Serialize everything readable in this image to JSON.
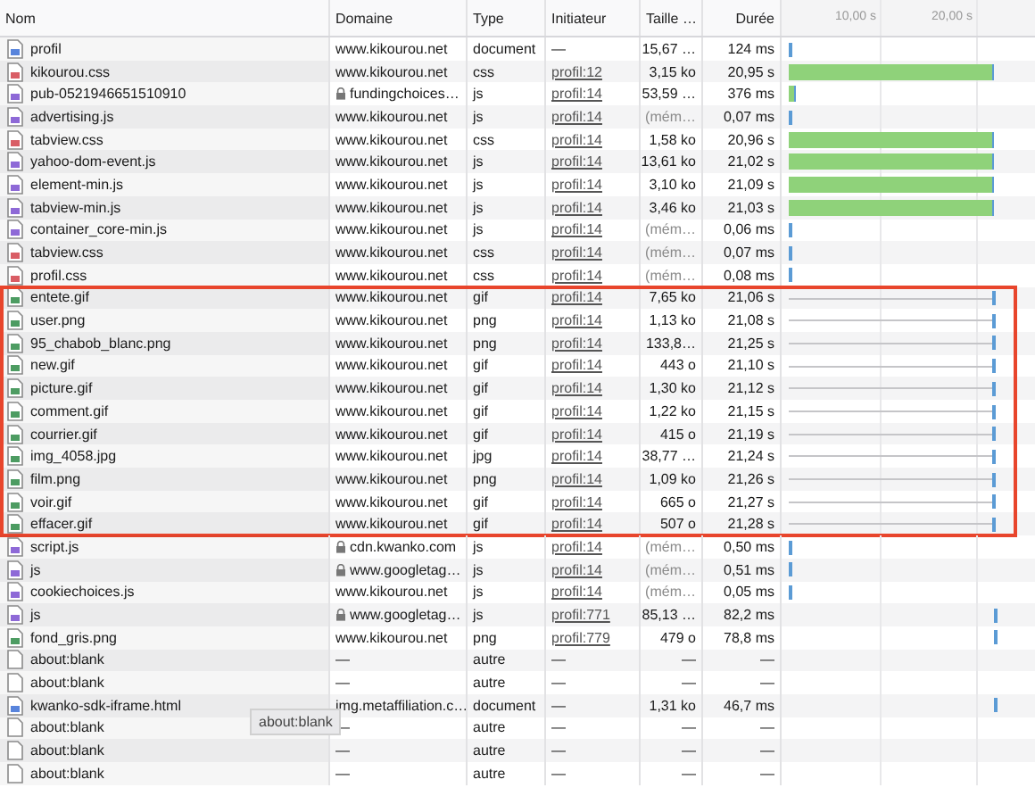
{
  "columns": [
    "Nom",
    "Domaine",
    "Type",
    "Initiateur",
    "Taille …",
    "Durée"
  ],
  "timeline": {
    "ticks": [
      "10,00 s",
      "20,00 s"
    ]
  },
  "groups": [
    {
      "highlighted": false,
      "rows": [
        {
          "name": "profil",
          "kind": "doc",
          "domain": "www.kikourou.net",
          "secure": false,
          "type": "document",
          "initiator": "—",
          "initiator_link": false,
          "size": "15,67 …",
          "cached": false,
          "duration": "124 ms",
          "timing": {
            "kind": "instant"
          }
        },
        {
          "name": "kikourou.css",
          "kind": "css",
          "domain": "www.kikourou.net",
          "secure": false,
          "type": "css",
          "initiator": "profil:12",
          "initiator_link": true,
          "size": "3,15 ko",
          "cached": false,
          "duration": "20,95 s",
          "timing": {
            "kind": "download"
          }
        },
        {
          "name": "pub-0521946651510910",
          "kind": "js",
          "domain": "fundingchoices…",
          "secure": true,
          "type": "js",
          "initiator": "profil:14",
          "initiator_link": true,
          "size": "53,59 …",
          "cached": false,
          "duration": "376 ms",
          "timing": {
            "kind": "short"
          }
        },
        {
          "name": "advertising.js",
          "kind": "js",
          "domain": "www.kikourou.net",
          "secure": false,
          "type": "js",
          "initiator": "profil:14",
          "initiator_link": true,
          "size": "(mém…",
          "cached": true,
          "duration": "0,07 ms",
          "timing": {
            "kind": "instant"
          }
        },
        {
          "name": "tabview.css",
          "kind": "css",
          "domain": "www.kikourou.net",
          "secure": false,
          "type": "css",
          "initiator": "profil:14",
          "initiator_link": true,
          "size": "1,58 ko",
          "cached": false,
          "duration": "20,96 s",
          "timing": {
            "kind": "download"
          }
        },
        {
          "name": "yahoo-dom-event.js",
          "kind": "js",
          "domain": "www.kikourou.net",
          "secure": false,
          "type": "js",
          "initiator": "profil:14",
          "initiator_link": true,
          "size": "13,61 ko",
          "cached": false,
          "duration": "21,02 s",
          "timing": {
            "kind": "download"
          }
        },
        {
          "name": "element-min.js",
          "kind": "js",
          "domain": "www.kikourou.net",
          "secure": false,
          "type": "js",
          "initiator": "profil:14",
          "initiator_link": true,
          "size": "3,10 ko",
          "cached": false,
          "duration": "21,09 s",
          "timing": {
            "kind": "download"
          }
        },
        {
          "name": "tabview-min.js",
          "kind": "js",
          "domain": "www.kikourou.net",
          "secure": false,
          "type": "js",
          "initiator": "profil:14",
          "initiator_link": true,
          "size": "3,46 ko",
          "cached": false,
          "duration": "21,03 s",
          "timing": {
            "kind": "download"
          }
        },
        {
          "name": "container_core-min.js",
          "kind": "js",
          "domain": "www.kikourou.net",
          "secure": false,
          "type": "js",
          "initiator": "profil:14",
          "initiator_link": true,
          "size": "(mém…",
          "cached": true,
          "duration": "0,06 ms",
          "timing": {
            "kind": "instant"
          }
        },
        {
          "name": "tabview.css",
          "kind": "css",
          "domain": "www.kikourou.net",
          "secure": false,
          "type": "css",
          "initiator": "profil:14",
          "initiator_link": true,
          "size": "(mém…",
          "cached": true,
          "duration": "0,07 ms",
          "timing": {
            "kind": "instant"
          }
        },
        {
          "name": "profil.css",
          "kind": "css",
          "domain": "www.kikourou.net",
          "secure": false,
          "type": "css",
          "initiator": "profil:14",
          "initiator_link": true,
          "size": "(mém…",
          "cached": true,
          "duration": "0,08 ms",
          "timing": {
            "kind": "instant"
          }
        }
      ]
    },
    {
      "highlighted": true,
      "rows": [
        {
          "name": "entete.gif",
          "kind": "img",
          "domain": "www.kikourou.net",
          "secure": false,
          "type": "gif",
          "initiator": "profil:14",
          "initiator_link": true,
          "size": "7,65 ko",
          "cached": false,
          "duration": "21,06 s",
          "timing": {
            "kind": "waiting"
          }
        },
        {
          "name": "user.png",
          "kind": "img",
          "domain": "www.kikourou.net",
          "secure": false,
          "type": "png",
          "initiator": "profil:14",
          "initiator_link": true,
          "size": "1,13 ko",
          "cached": false,
          "duration": "21,08 s",
          "timing": {
            "kind": "waiting"
          }
        },
        {
          "name": "95_chabob_blanc.png",
          "kind": "img",
          "domain": "www.kikourou.net",
          "secure": false,
          "type": "png",
          "initiator": "profil:14",
          "initiator_link": true,
          "size": "133,8…",
          "cached": false,
          "duration": "21,25 s",
          "timing": {
            "kind": "waiting"
          }
        },
        {
          "name": "new.gif",
          "kind": "img",
          "domain": "www.kikourou.net",
          "secure": false,
          "type": "gif",
          "initiator": "profil:14",
          "initiator_link": true,
          "size": "443 o",
          "cached": false,
          "duration": "21,10 s",
          "timing": {
            "kind": "waiting"
          }
        },
        {
          "name": "picture.gif",
          "kind": "img",
          "domain": "www.kikourou.net",
          "secure": false,
          "type": "gif",
          "initiator": "profil:14",
          "initiator_link": true,
          "size": "1,30 ko",
          "cached": false,
          "duration": "21,12 s",
          "timing": {
            "kind": "waiting"
          }
        },
        {
          "name": "comment.gif",
          "kind": "img",
          "domain": "www.kikourou.net",
          "secure": false,
          "type": "gif",
          "initiator": "profil:14",
          "initiator_link": true,
          "size": "1,22 ko",
          "cached": false,
          "duration": "21,15 s",
          "timing": {
            "kind": "waiting"
          }
        },
        {
          "name": "courrier.gif",
          "kind": "img",
          "domain": "www.kikourou.net",
          "secure": false,
          "type": "gif",
          "initiator": "profil:14",
          "initiator_link": true,
          "size": "415 o",
          "cached": false,
          "duration": "21,19 s",
          "timing": {
            "kind": "waiting"
          }
        },
        {
          "name": "img_4058.jpg",
          "kind": "img",
          "domain": "www.kikourou.net",
          "secure": false,
          "type": "jpg",
          "initiator": "profil:14",
          "initiator_link": true,
          "size": "38,77 …",
          "cached": false,
          "duration": "21,24 s",
          "timing": {
            "kind": "waiting"
          }
        },
        {
          "name": "film.png",
          "kind": "img",
          "domain": "www.kikourou.net",
          "secure": false,
          "type": "png",
          "initiator": "profil:14",
          "initiator_link": true,
          "size": "1,09 ko",
          "cached": false,
          "duration": "21,26 s",
          "timing": {
            "kind": "waiting"
          }
        },
        {
          "name": "voir.gif",
          "kind": "img",
          "domain": "www.kikourou.net",
          "secure": false,
          "type": "gif",
          "initiator": "profil:14",
          "initiator_link": true,
          "size": "665 o",
          "cached": false,
          "duration": "21,27 s",
          "timing": {
            "kind": "waiting"
          }
        },
        {
          "name": "effacer.gif",
          "kind": "img",
          "domain": "www.kikourou.net",
          "secure": false,
          "type": "gif",
          "initiator": "profil:14",
          "initiator_link": true,
          "size": "507 o",
          "cached": false,
          "duration": "21,28 s",
          "timing": {
            "kind": "waiting"
          }
        }
      ]
    },
    {
      "highlighted": false,
      "rows": [
        {
          "name": "script.js",
          "kind": "js",
          "domain": "cdn.kwanko.com",
          "secure": true,
          "type": "js",
          "initiator": "profil:14",
          "initiator_link": true,
          "size": "(mém…",
          "cached": true,
          "duration": "0,50 ms",
          "timing": {
            "kind": "instant"
          }
        },
        {
          "name": "js",
          "kind": "js",
          "domain": "www.googletag…",
          "secure": true,
          "type": "js",
          "initiator": "profil:14",
          "initiator_link": true,
          "size": "(mém…",
          "cached": true,
          "duration": "0,51 ms",
          "timing": {
            "kind": "instant"
          }
        },
        {
          "name": "cookiechoices.js",
          "kind": "js",
          "domain": "www.kikourou.net",
          "secure": false,
          "type": "js",
          "initiator": "profil:14",
          "initiator_link": true,
          "size": "(mém…",
          "cached": true,
          "duration": "0,05 ms",
          "timing": {
            "kind": "instant"
          }
        },
        {
          "name": "js",
          "kind": "js",
          "domain": "www.googletag…",
          "secure": true,
          "type": "js",
          "initiator": "profil:771",
          "initiator_link": true,
          "size": "85,13 …",
          "cached": false,
          "duration": "82,2 ms",
          "timing": {
            "kind": "late"
          }
        },
        {
          "name": "fond_gris.png",
          "kind": "img",
          "domain": "www.kikourou.net",
          "secure": false,
          "type": "png",
          "initiator": "profil:779",
          "initiator_link": true,
          "size": "479 o",
          "cached": false,
          "duration": "78,8 ms",
          "timing": {
            "kind": "late"
          }
        },
        {
          "name": "about:blank",
          "kind": "blank",
          "domain": "—",
          "secure": false,
          "type": "autre",
          "initiator": "—",
          "initiator_link": false,
          "size": "—",
          "cached": false,
          "duration": "—"
        },
        {
          "name": "about:blank",
          "kind": "blank",
          "domain": "—",
          "secure": false,
          "type": "autre",
          "initiator": "—",
          "initiator_link": false,
          "size": "—",
          "cached": false,
          "duration": "—"
        },
        {
          "name": "kwanko-sdk-iframe.html",
          "kind": "doc",
          "domain": "img.metaffiliation.c…",
          "secure": false,
          "type": "document",
          "initiator": "—",
          "initiator_link": false,
          "size": "1,31 ko",
          "cached": false,
          "duration": "46,7 ms",
          "timing": {
            "kind": "late"
          }
        },
        {
          "name": "about:blank",
          "kind": "blank",
          "domain": "—",
          "secure": false,
          "type": "autre",
          "initiator": "—",
          "initiator_link": false,
          "size": "—",
          "cached": false,
          "duration": "—"
        },
        {
          "name": "about:blank",
          "kind": "blank",
          "domain": "—",
          "secure": false,
          "type": "autre",
          "initiator": "—",
          "initiator_link": false,
          "size": "—",
          "cached": false,
          "duration": "—"
        },
        {
          "name": "about:blank",
          "kind": "blank",
          "domain": "—",
          "secure": false,
          "type": "autre",
          "initiator": "—",
          "initiator_link": false,
          "size": "—",
          "cached": false,
          "duration": "—"
        }
      ]
    }
  ],
  "tooltip": {
    "text": "about:blank"
  }
}
